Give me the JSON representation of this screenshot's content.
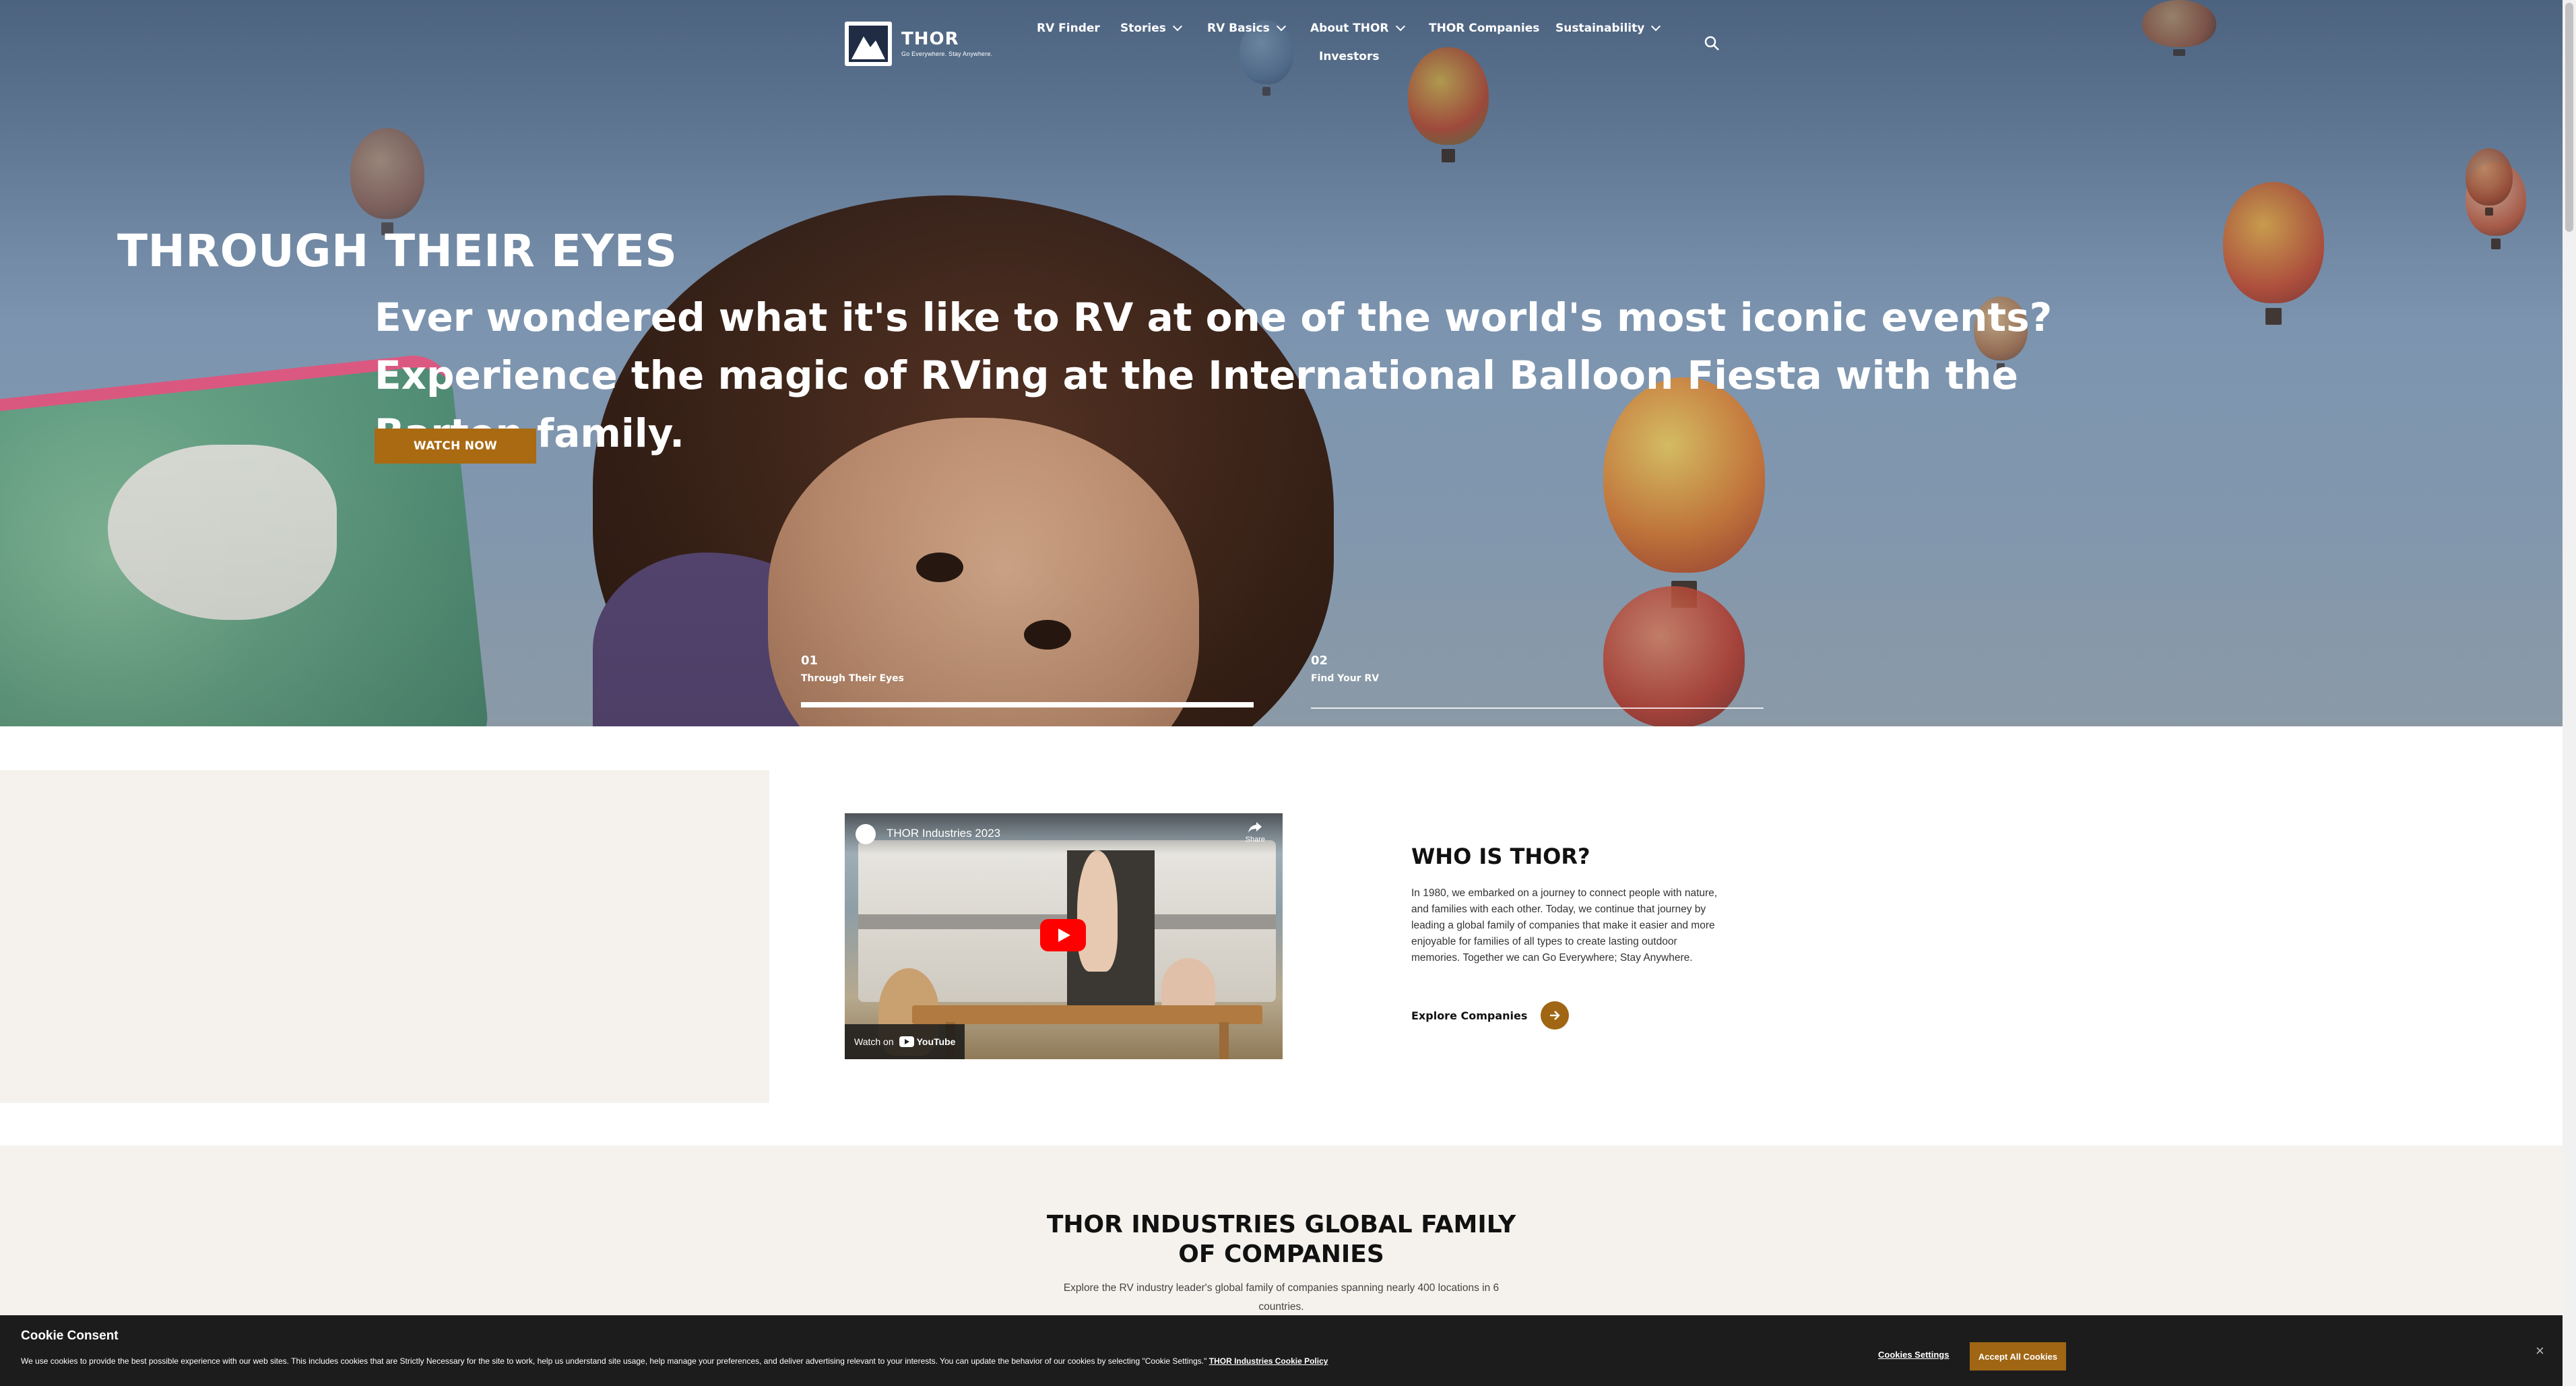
{
  "brand": {
    "name": "THOR",
    "tagline": "Go Everywhere. Stay Anywhere.",
    "accent": "#a96a12"
  },
  "nav": {
    "rv_finder": "RV Finder",
    "stories": "Stories",
    "rv_basics": "RV Basics",
    "about": "About THOR",
    "companies": "THOR Companies",
    "sustainability": "Sustainability",
    "investors": "Investors",
    "search_icon": "search-icon"
  },
  "hero": {
    "title": "THROUGH THEIR EYES",
    "subtitle": "Ever wondered what it's like to RV at one of the world's most iconic events? Experience the magic of RVing at the International Balloon Fiesta with the Barton family.",
    "cta": "WATCH NOW",
    "slides": [
      {
        "num": "01",
        "label": "Through Their Eyes",
        "active": true
      },
      {
        "num": "02",
        "label": "Find Your RV",
        "active": false
      }
    ]
  },
  "video": {
    "title": "THOR Industries 2023",
    "share": "Share",
    "watch_on": "Watch on",
    "youtube": "YouTube"
  },
  "who": {
    "title": "WHO IS THOR?",
    "body": "In 1980, we embarked on a journey to connect people with nature, and families with each other. Today, we continue that journey by leading a global family of companies that make it easier and more enjoyable for families of all types to create lasting outdoor memories. Together we can Go Everywhere; Stay Anywhere.",
    "cta": "Explore Companies"
  },
  "family": {
    "title": "THOR INDUSTRIES GLOBAL FAMILY OF COMPANIES",
    "body": "Explore the RV industry leader's global family of companies spanning nearly 400 locations in 6 countries."
  },
  "cookie": {
    "title": "Cookie Consent",
    "text": "We use cookies to provide the best possible experience with our web sites. This includes cookies that are Strictly Necessary for the site to work, help us understand site usage, help manage your preferences, and deliver advertising relevant to your interests. You can update the behavior of our cookies by selecting \"Cookie Settings.\"",
    "policy_link": "THOR Industries Cookie Policy",
    "settings": "Cookies Settings",
    "accept": "Accept All Cookies",
    "close": "×"
  }
}
